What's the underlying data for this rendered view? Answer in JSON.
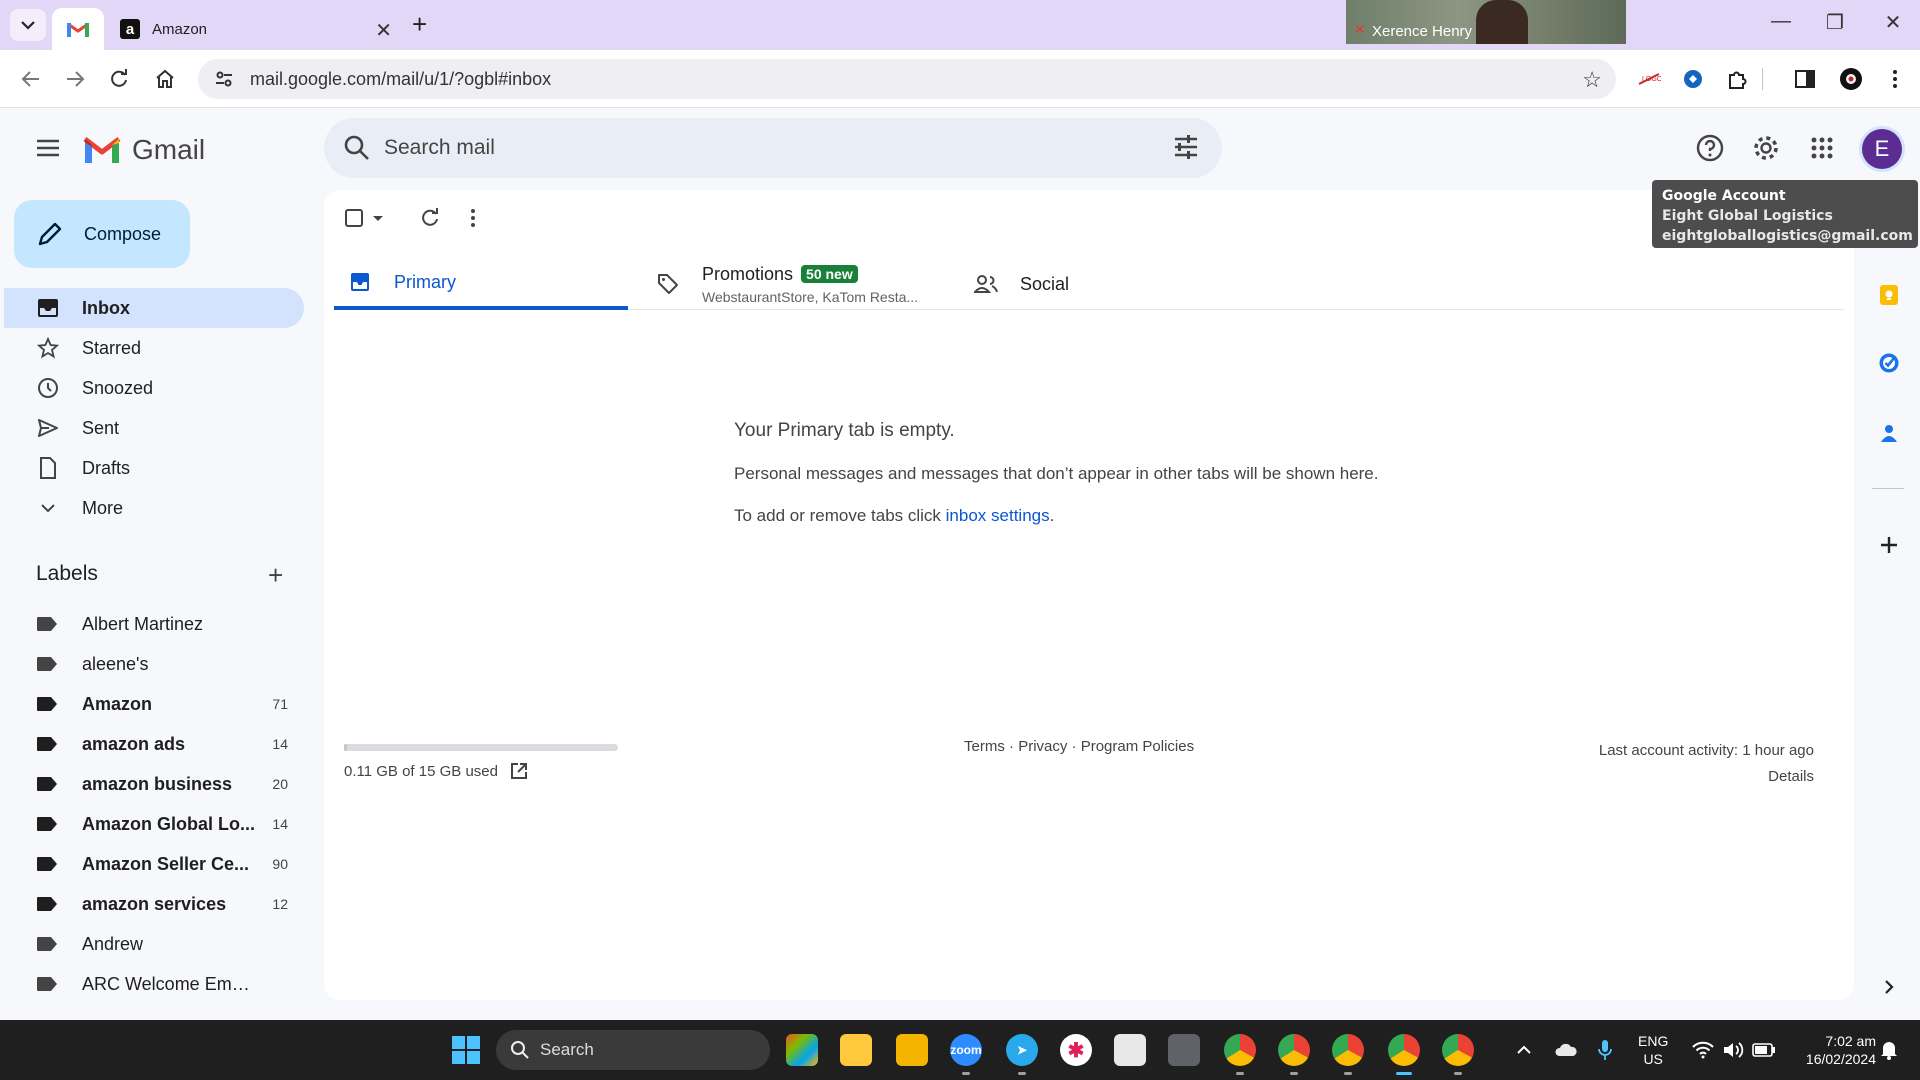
{
  "browser": {
    "tabs": [
      {
        "label": "",
        "favicon": "gmail-icon",
        "active": true
      },
      {
        "label": "Amazon",
        "favicon": "amazon-icon",
        "active": false
      }
    ],
    "url": "mail.google.com/mail/u/1/?ogbl#inbox",
    "video_overlay_name": "Xerence Henry"
  },
  "gmail": {
    "app_name": "Gmail",
    "search_placeholder": "Search mail",
    "account_tooltip": {
      "title": "Google Account",
      "name": "Eight Global Logistics",
      "email": "eightgloballogistics@gmail.com"
    },
    "avatar_letter": "E",
    "compose_label": "Compose",
    "nav": [
      {
        "label": "Inbox",
        "icon": "inbox-icon",
        "active": true
      },
      {
        "label": "Starred",
        "icon": "star-icon"
      },
      {
        "label": "Snoozed",
        "icon": "clock-icon"
      },
      {
        "label": "Sent",
        "icon": "send-icon"
      },
      {
        "label": "Drafts",
        "icon": "draft-icon"
      },
      {
        "label": "More",
        "icon": "chevron-down-icon"
      }
    ],
    "labels_header": "Labels",
    "labels": [
      {
        "name": "Albert Martinez",
        "count": "",
        "bold": false
      },
      {
        "name": "aleene's",
        "count": "",
        "bold": false
      },
      {
        "name": "Amazon",
        "count": "71",
        "bold": true
      },
      {
        "name": "amazon ads",
        "count": "14",
        "bold": true
      },
      {
        "name": "amazon business",
        "count": "20",
        "bold": true
      },
      {
        "name": "Amazon Global Lo...",
        "count": "14",
        "bold": true
      },
      {
        "name": "Amazon Seller Ce...",
        "count": "90",
        "bold": true
      },
      {
        "name": "amazon services",
        "count": "12",
        "bold": true
      },
      {
        "name": "Andrew",
        "count": "",
        "bold": false
      },
      {
        "name": "ARC Welcome Emails",
        "count": "",
        "bold": false
      }
    ],
    "category_tabs": {
      "primary": "Primary",
      "promotions": "Promotions",
      "promotions_badge": "50 new",
      "promotions_senders": "WebstaurantStore, KaTom Resta...",
      "social": "Social"
    },
    "empty_state": {
      "title": "Your Primary tab is empty.",
      "body": "Personal messages and messages that don’t appear in other tabs will be shown here.",
      "settings_prefix": "To add or remove tabs click ",
      "settings_link": "inbox settings",
      "settings_suffix": "."
    },
    "storage": {
      "text": "0.11 GB of 15 GB used",
      "fraction_used": 0.0073
    },
    "footer": {
      "terms": "Terms",
      "privacy": "Privacy",
      "program_policies": "Program Policies",
      "sep": " · ",
      "last_activity": "Last account activity: 1 hour ago",
      "details": "Details"
    }
  },
  "taskbar": {
    "search_label": "Search",
    "lang_line1": "ENG",
    "lang_line2": "US",
    "time": "7:02 am",
    "date": "16/02/2024"
  },
  "colors": {
    "accent": "#0b57d0",
    "active_nav": "#d3e3fd",
    "compose_bg": "#c2e7ff",
    "promo_badge": "#188038",
    "avatar": "#5b2c91"
  }
}
